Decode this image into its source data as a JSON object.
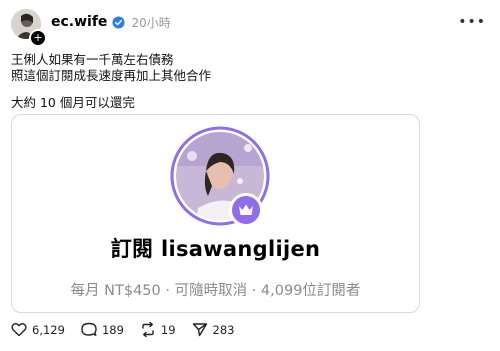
{
  "post": {
    "username": "ec.wife",
    "time": "20小時",
    "more_icon": "more-icon",
    "text_lines": [
      "王俐人如果有一千萬左右債務",
      "照這個訂閱成長速度再加上其他合作"
    ],
    "text_line3": "大約 10 個月可以還完"
  },
  "card": {
    "title": "訂閱 lisawanglijen",
    "subtitle": "每月 NT$450 · 可隨時取消 · 4,099位訂閱者",
    "badge_icon": "crown-icon",
    "accent": "#8f6ee8"
  },
  "actions": {
    "likes": "6,129",
    "comments": "189",
    "reposts": "19",
    "shares": "283"
  }
}
